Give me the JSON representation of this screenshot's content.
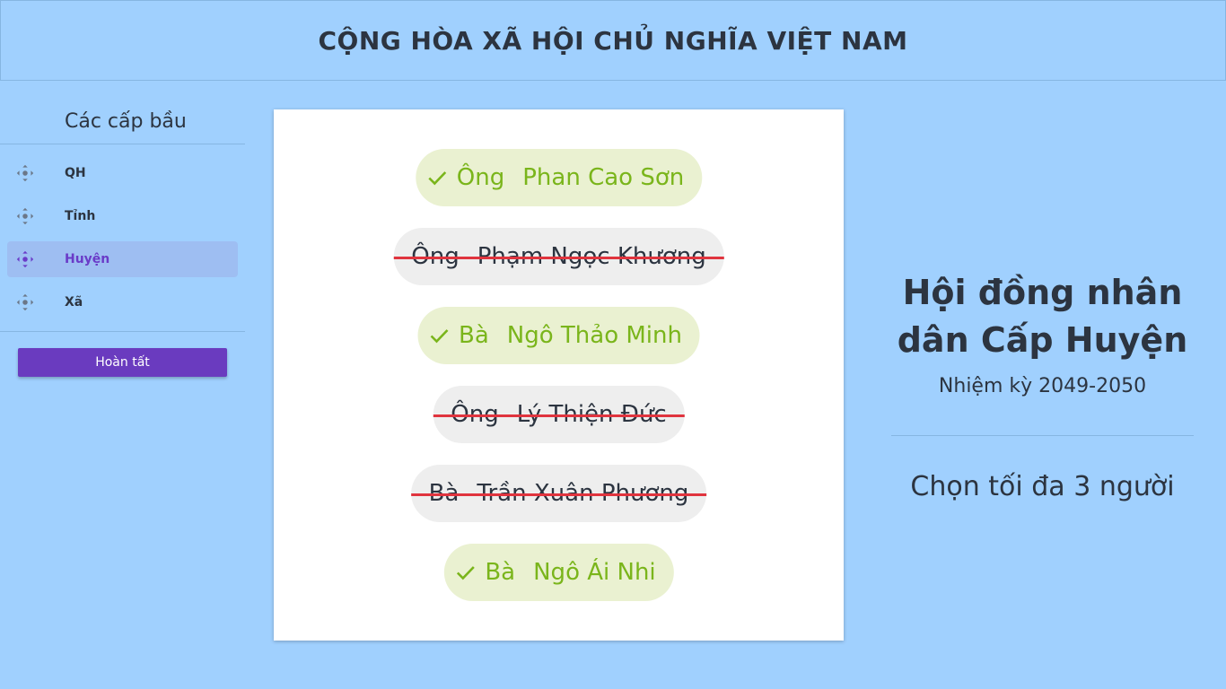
{
  "header": {
    "title": "CỘNG HÒA XÃ HỘI CHỦ NGHĨA VIỆT NAM"
  },
  "sidebar": {
    "heading": "Các cấp bầu",
    "items": [
      {
        "label": "QH",
        "icon": "move-icon",
        "active": false
      },
      {
        "label": "Tỉnh",
        "icon": "move-icon",
        "active": false
      },
      {
        "label": "Huyện",
        "icon": "move-icon",
        "active": true
      },
      {
        "label": "Xã",
        "icon": "move-icon",
        "active": false
      }
    ],
    "done_label": "Hoàn tất"
  },
  "candidates": [
    {
      "title": "Ông",
      "name": "Phan Cao Sơn",
      "status": "selected"
    },
    {
      "title": "Ông",
      "name": "Phạm Ngọc Khương",
      "status": "rejected"
    },
    {
      "title": "Bà",
      "name": "Ngô Thảo Minh",
      "status": "selected"
    },
    {
      "title": "Ông",
      "name": "Lý Thiện Đức",
      "status": "rejected"
    },
    {
      "title": "Bà",
      "name": "Trần Xuân Phương",
      "status": "rejected"
    },
    {
      "title": "Bà",
      "name": "Ngô Ái Nhi",
      "status": "selected"
    }
  ],
  "info": {
    "council_line1": "Hội đồng nhân",
    "council_line2": "dân Cấp Huyện",
    "term": "Nhiệm kỳ 2049-2050",
    "choose_max": "Chọn tối đa 3 người"
  },
  "colors": {
    "background": "#a0d0fe",
    "accent": "#6a3bbf",
    "selected_text": "#7ab51b",
    "selected_bg": "#eaf1d1",
    "rejected_bg": "#eeeeee",
    "strike": "#e0343e"
  }
}
